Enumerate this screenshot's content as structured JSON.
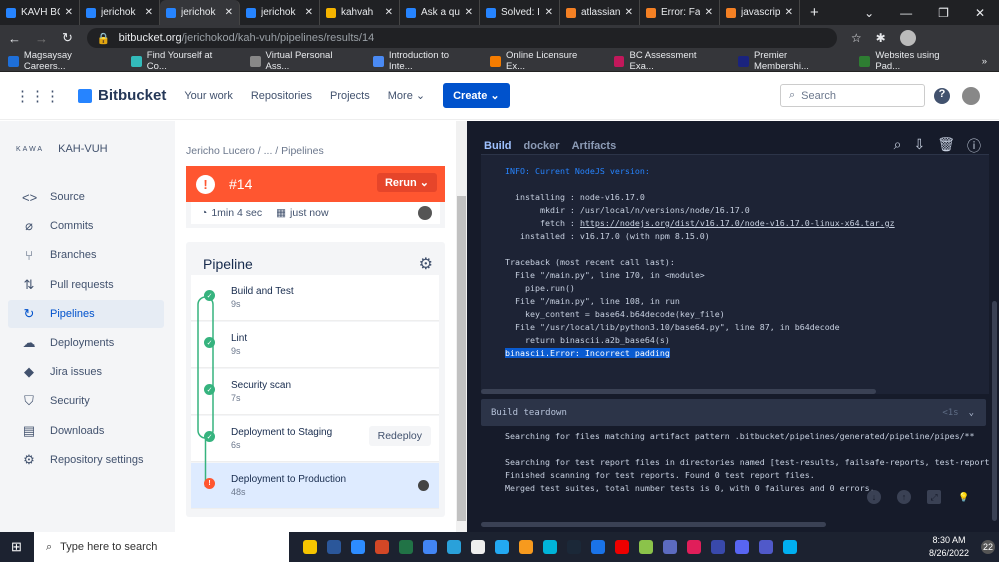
{
  "browser": {
    "tabs": [
      {
        "title": "KAVH BC",
        "color": "#2684ff"
      },
      {
        "title": "jerichok",
        "color": "#2684ff"
      },
      {
        "title": "jerichok",
        "color": "#2684ff",
        "active": true
      },
      {
        "title": "jerichok",
        "color": "#2684ff"
      },
      {
        "title": "kahvah",
        "color": "#f5b400"
      },
      {
        "title": "Ask a qu",
        "color": "#2684ff"
      },
      {
        "title": "Solved: I",
        "color": "#2684ff"
      },
      {
        "title": "atlassian",
        "color": "#f48024"
      },
      {
        "title": "Error: Fa",
        "color": "#f48024"
      },
      {
        "title": "javascrip",
        "color": "#f48024"
      }
    ],
    "new_tab": "+",
    "url_host": "bitbucket.org",
    "url_path": "/jerichokod/kah-vuh/pipelines/results/14",
    "bookmarks": [
      {
        "label": "Magsaysay Careers...",
        "color": "#1e6fd9"
      },
      {
        "label": "Find Yourself at Co...",
        "color": "#3bb"
      },
      {
        "label": "Virtual Personal Ass...",
        "color": "#888"
      },
      {
        "label": "Introduction to Inte...",
        "color": "#4a8af4"
      },
      {
        "label": "Online Licensure Ex...",
        "color": "#f57c00"
      },
      {
        "label": "BC Assessment Exa...",
        "color": "#c2185b"
      },
      {
        "label": "Premier Membershi...",
        "color": "#1a237e"
      },
      {
        "label": "Websites using Pad...",
        "color": "#2e7d32"
      }
    ],
    "bookmarks_more": "»"
  },
  "header": {
    "product": "Bitbucket",
    "nav": [
      "Your work",
      "Repositories",
      "Projects",
      "More ⌄"
    ],
    "create": "Create ⌄",
    "search_placeholder": "Search",
    "help": "?"
  },
  "sidebar": {
    "repo_logo": "KAWA",
    "repo_name": "KAH-VUH",
    "items": [
      {
        "label": "Source",
        "icon": "<>"
      },
      {
        "label": "Commits",
        "icon": "⌀"
      },
      {
        "label": "Branches",
        "icon": "⑂"
      },
      {
        "label": "Pull requests",
        "icon": "⇅"
      },
      {
        "label": "Pipelines",
        "icon": "↻",
        "selected": true
      },
      {
        "label": "Deployments",
        "icon": "☁"
      },
      {
        "label": "Jira issues",
        "icon": "◆"
      },
      {
        "label": "Security",
        "icon": "⛉"
      },
      {
        "label": "Downloads",
        "icon": "▤"
      },
      {
        "label": "Repository settings",
        "icon": "⚙"
      }
    ]
  },
  "pipeline": {
    "breadcrumb": "Jericho Lucero  /  ...  /  Pipelines",
    "run": "#14",
    "rerun": "Rerun ⌄",
    "status_color": "#ff5630",
    "duration": "1min 4 sec",
    "when": "just now",
    "title": "Pipeline",
    "steps": [
      {
        "name": "Build and Test",
        "time": "9s",
        "status": "success"
      },
      {
        "name": "Lint",
        "time": "9s",
        "status": "success"
      },
      {
        "name": "Security scan",
        "time": "7s",
        "status": "success"
      },
      {
        "name": "Deployment to Staging",
        "time": "6s",
        "status": "success",
        "action": "Redeploy"
      },
      {
        "name": "Deployment to Production",
        "time": "48s",
        "status": "failed",
        "selected": true
      }
    ]
  },
  "log": {
    "tabs": [
      "Build",
      "docker",
      "Artifacts"
    ],
    "info_line": "INFO: Current NodeJS version:",
    "lines": [
      "  installing : node-v16.17.0",
      "       mkdir : /usr/local/n/versions/node/16.17.0",
      "       fetch : "
    ],
    "fetch_url": "https://nodejs.org/dist/v16.17.0/node-v16.17.0-linux-x64.tar.gz",
    "lines2": [
      "   installed : v16.17.0 (with npm 8.15.0)",
      "",
      "Traceback (most recent call last):",
      "  File \"/main.py\", line 170, in <module>",
      "    pipe.run()",
      "  File \"/main.py\", line 108, in run",
      "    key_content = base64.b64decode(key_file)",
      "  File \"/usr/local/lib/python3.10/base64.py\", line 87, in b64decode",
      "    return binascii.a2b_base64(s)"
    ],
    "error": "binascii.Error: Incorrect padding",
    "teardown_title": "Build teardown",
    "teardown_time": "<1s",
    "teardown_lines": [
      "Searching for files matching artifact pattern .bitbucket/pipelines/generated/pipeline/pipes/**",
      "",
      "Searching for test report files in directories named [test-results, failsafe-reports, test-reports, T",
      "Finished scanning for test reports. Found 0 test report files.",
      "Merged test suites, total number tests is 0, with 0 failures and 0 errors."
    ]
  },
  "taskbar": {
    "search_placeholder": "Type here to search",
    "time": "8:30 AM",
    "date": "8/26/2022",
    "notifications": "22",
    "apps": [
      "#f5c400",
      "#2b579a",
      "#2d8cff",
      "#d24726",
      "#217346",
      "#4285f4",
      "#2aa1da",
      "#eeeeee",
      "#23a9f2",
      "#f79a1e",
      "#00b4d8",
      "#1b2838",
      "#1a73e8",
      "#e00",
      "#8bc34a",
      "#5c6bc0",
      "#e01e5a",
      "#3949ab",
      "#5865f2",
      "#5059c9",
      "#00aff0"
    ]
  }
}
